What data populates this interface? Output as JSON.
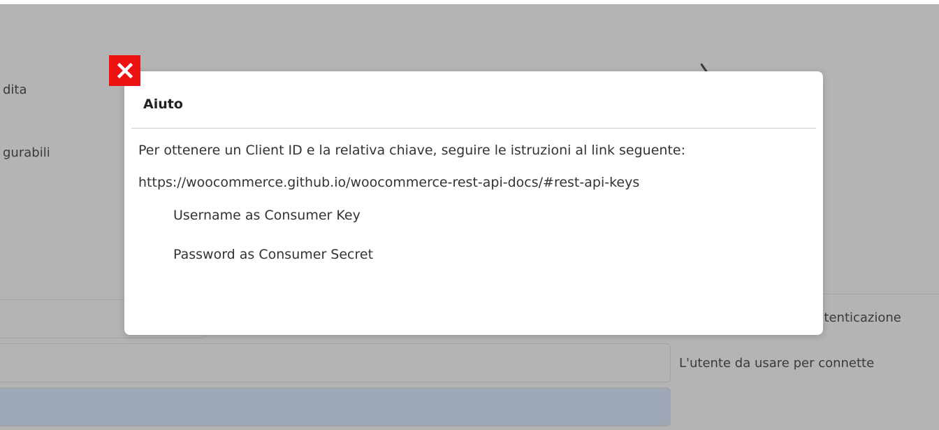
{
  "background": {
    "side_labels": [
      "dita",
      "gurabili"
    ],
    "right_labels": [
      "utenticazione",
      "L'utente da usare per connette"
    ]
  },
  "modal": {
    "title": "Aiuto",
    "instruction": "Per ottenere un Client ID e la relativa chiave, seguire le istruzioni al link seguente:",
    "link": "https://woocommerce.github.io/woocommerce-rest-api-docs/#rest-api-keys",
    "items": [
      "Username as Consumer Key",
      "Password as Consumer Secret"
    ]
  },
  "icons": {
    "close": "close-icon"
  },
  "colors": {
    "close_button": "#ee1111",
    "overlay": "#b4b4b4",
    "modal": "#ffffff"
  }
}
